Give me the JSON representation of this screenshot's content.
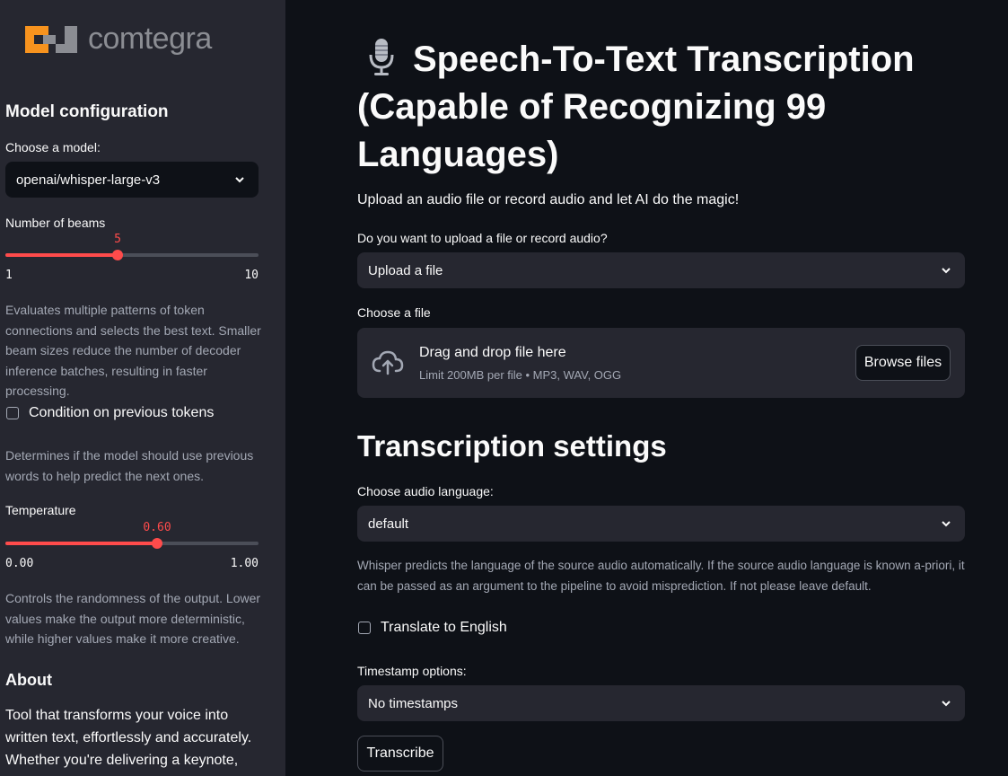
{
  "sidebar": {
    "logo_text": "comtegra",
    "model_config_heading": "Model configuration",
    "model_label": "Choose a model:",
    "model_value": "openai/whisper-large-v3",
    "beams": {
      "label": "Number of beams",
      "value": 5,
      "min": 1,
      "max": 10,
      "value_text": "5",
      "min_text": "1",
      "max_text": "10"
    },
    "beams_help": "Evaluates multiple patterns of token connections and selects the best text. Smaller beam sizes reduce the number of decoder inference batches, resulting in faster processing.",
    "condition_label": "Condition on previous tokens",
    "condition_help": "Determines if the model should use previous words to help predict the next ones.",
    "temperature": {
      "label": "Temperature",
      "value": 0.6,
      "min": 0,
      "max": 1,
      "value_text": "0.60",
      "min_text": "0.00",
      "max_text": "1.00"
    },
    "temperature_help": "Controls the randomness of the output. Lower values make the output more deterministic, while higher values make it more creative.",
    "about_heading": "About",
    "about_text": "Tool that transforms your voice into written text, effortlessly and accurately. Whether you're delivering a keynote,"
  },
  "main": {
    "title_icon": "microphone-icon",
    "title": "Speech-To-Text Transcription (Capable of Recognizing 99 Languages)",
    "subtitle": "Upload an audio file or record audio and let AI do the magic!",
    "source_label": "Do you want to upload a file or record audio?",
    "source_value": "Upload a file",
    "file_label": "Choose a file",
    "dropzone_title": "Drag and drop file here",
    "dropzone_limit": "Limit 200MB per file • MP3, WAV, OGG",
    "browse_label": "Browse files",
    "settings_heading": "Transcription settings",
    "language_label": "Choose audio language:",
    "language_value": "default",
    "language_help": "Whisper predicts the language of the source audio automatically. If the source audio language is known a-priori, it can be passed as an argument to the pipeline to avoid misprediction. If not please leave default.",
    "translate_label": "Translate to English",
    "timestamp_label": "Timestamp options:",
    "timestamp_value": "No timestamps",
    "transcribe_label": "Transcribe"
  },
  "colors": {
    "accent": "#ff4b4b",
    "sidebar_bg": "#262730",
    "main_bg": "#0e1117",
    "logo_orange": "#f7931e"
  }
}
